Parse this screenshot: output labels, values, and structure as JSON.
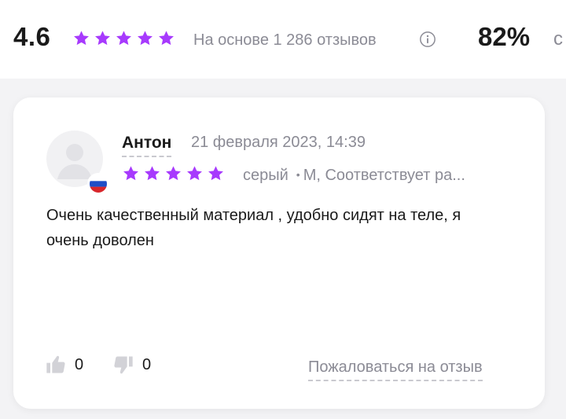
{
  "summary": {
    "rating": "4.6",
    "stars_filled": 5,
    "based_on": "На основе 1 286 отзывов",
    "percent": "82%",
    "percent_suffix_cut": "с"
  },
  "review": {
    "author": "Антон",
    "date": "21 февраля 2023, 14:39",
    "stars_filled": 5,
    "color_variant": "серый",
    "dot": "•",
    "size_fit": "M, Соответствует ра...",
    "text": "Очень качественный материал , удобно сидят на теле, я очень доволен",
    "likes": "0",
    "dislikes": "0",
    "report_label": "Пожаловаться на отзыв",
    "country_flag": "russia-flag-icon"
  },
  "colors": {
    "star": "#a73afd",
    "muted_text": "#8b8b95",
    "text": "#1a1a1a",
    "background": "#f3f3f5",
    "card": "#ffffff"
  }
}
